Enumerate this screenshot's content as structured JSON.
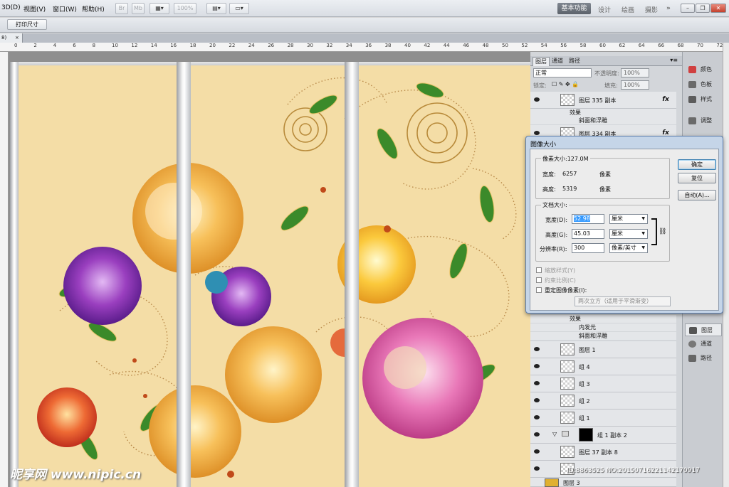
{
  "menubar": {
    "items": [
      "3D(D)",
      "视图(V)",
      "窗口(W)",
      "帮助(H)"
    ],
    "zoom": "100%",
    "workspace_active": "基本功能",
    "workspaces": [
      "设计",
      "绘画",
      "摄影",
      "»"
    ]
  },
  "options": {
    "print_size": "打印尺寸"
  },
  "doc_tab": {
    "label": "8)",
    "close": "×"
  },
  "ruler": {
    "labels": [
      "0",
      "2",
      "4",
      "6",
      "8",
      "10",
      "12",
      "14",
      "16",
      "18",
      "20",
      "22",
      "24",
      "26",
      "28",
      "30",
      "32",
      "34",
      "36",
      "38",
      "40",
      "42",
      "44",
      "46",
      "48",
      "50",
      "52",
      "54",
      "56",
      "58",
      "60",
      "62",
      "64",
      "66",
      "68",
      "70",
      "72"
    ]
  },
  "layers_panel": {
    "tabs": [
      "图层",
      "通道",
      "路径"
    ],
    "blend_mode": "正常",
    "opacity_label": "不透明度:",
    "opacity": "100%",
    "lock_label": "锁定:",
    "fill_label": "填充:",
    "fill": "100%",
    "top_layers": [
      {
        "name": "图层 335 副本",
        "fx": "fx"
      },
      {
        "name": "图层 334 副本",
        "fx": "fx"
      }
    ],
    "top_effects": [
      "效果",
      "斜面和浮雕"
    ],
    "mid_effects": [
      "效果",
      "内发光",
      "斜面和浮雕"
    ],
    "bottom_layers": [
      {
        "name": "图层 1"
      },
      {
        "name": "组 4"
      },
      {
        "name": "组 3"
      },
      {
        "name": "组 2"
      },
      {
        "name": "组 1"
      },
      {
        "name": "组 1 副本 2"
      },
      {
        "name": "图层 37 副本 8"
      },
      {
        "name": "图层 3"
      }
    ]
  },
  "right_icons": {
    "top": [
      {
        "label": "颜色",
        "color": "#d04040"
      },
      {
        "label": "色板",
        "color": "#6a6a6a"
      },
      {
        "label": "样式",
        "color": "#5c5c5c"
      },
      {
        "label": "调整",
        "color": "#6a6a6a"
      }
    ],
    "bottom": [
      {
        "label": "图层",
        "color": "#555555"
      },
      {
        "label": "通道",
        "color": "#777777"
      },
      {
        "label": "路径",
        "color": "#666666"
      }
    ]
  },
  "dialog": {
    "title": "图像大小",
    "pixel_size_label": "像素大小:127.0M",
    "pixel_width_label": "宽度:",
    "pixel_width": "6257",
    "pixel_height_label": "高度:",
    "pixel_height": "5319",
    "pixel_unit": "像素",
    "doc_size_label": "文档大小:",
    "width_label": "宽度(D):",
    "width": "52.98",
    "width_unit": "厘米",
    "height_label": "高度(G):",
    "height": "45.03",
    "height_unit": "厘米",
    "res_label": "分辨率(R):",
    "resolution": "300",
    "res_unit": "像素/英寸",
    "scale_styles": "缩放样式(Y)",
    "constrain": "约束比例(C)",
    "resample": "重定图像像素(I):",
    "resample_method": "两次立方（适用于平滑渐变）",
    "ok": "确定",
    "reset": "复位",
    "auto": "自动(A)..."
  },
  "watermark": {
    "site": "昵享网 www.nipic.cn",
    "id": "ID:8863525 NO:20150716221142170917"
  },
  "colors": {
    "artboard": "#f4dda6",
    "dialog_frame": "#c5d5e8",
    "accent_selection": "#3399ff"
  }
}
